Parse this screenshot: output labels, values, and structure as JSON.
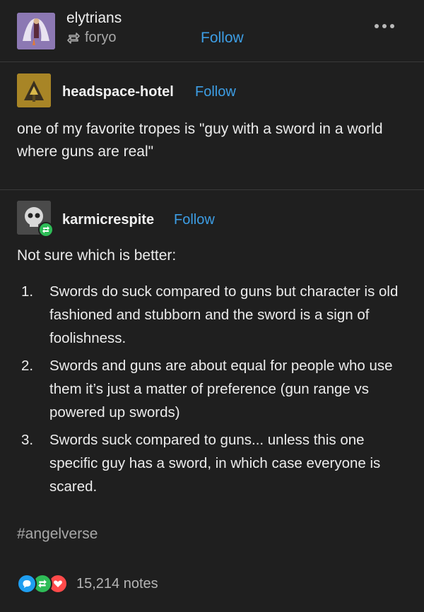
{
  "header": {
    "username": "elytrians",
    "reblogged_from": "foryo",
    "follow_label": "Follow"
  },
  "post1": {
    "username": "headspace-hotel",
    "follow_label": "Follow",
    "text": "one of my favorite tropes is \"guy with a sword in a world where guns are real\""
  },
  "post2": {
    "username": "karmicrespite",
    "follow_label": "Follow",
    "intro": "Not sure which is better:",
    "items": [
      {
        "num": "1.",
        "text": "Swords do suck compared to guns but character is old fashioned and stubborn and the sword is a sign of foolishness."
      },
      {
        "num": "2.",
        "text": "Swords and guns are about equal for people who use them it’s just a matter of preference (gun range vs powered up swords)"
      },
      {
        "num": "3.",
        "text": "Swords suck compared to guns... unless this one specific guy has a sword, in which case everyone is scared."
      }
    ]
  },
  "tags": [
    "#angelverse"
  ],
  "notes": {
    "count_label": "15,214 notes",
    "icons": [
      "reply-icon",
      "reblog-icon",
      "heart-icon"
    ],
    "colors": {
      "reply": "#1f9ef0",
      "reblog": "#2ebc57",
      "like": "#ff4a4a"
    }
  },
  "colors": {
    "background": "#1f1f1f",
    "link": "#3d9ee5",
    "muted": "#a8a8a8"
  }
}
